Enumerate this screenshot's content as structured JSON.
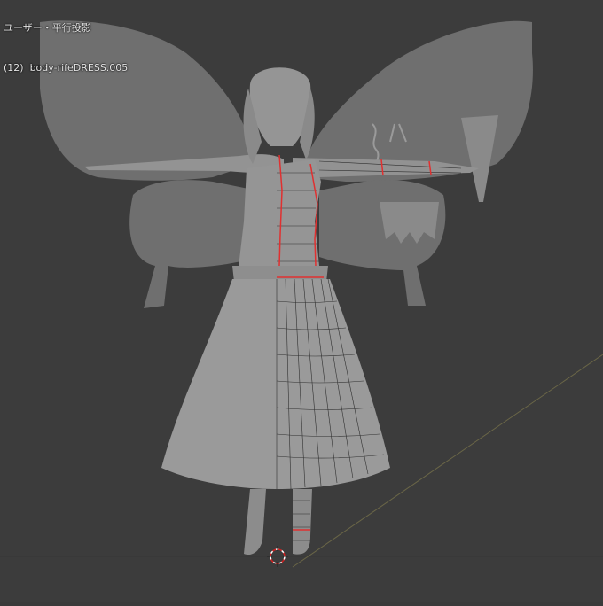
{
  "viewport": {
    "view_label": "ユーザー・平行投影",
    "object_info": "(12)  body-rifeDRESS.005"
  },
  "colors": {
    "background": "#3c3c3c",
    "grid_line": "#353535",
    "model": "#8f8f8f",
    "wing": "#6f6f6f",
    "wireframe": "#1e1e1e",
    "seam": "#e03030",
    "floor_axis": "#6e6a4e"
  }
}
